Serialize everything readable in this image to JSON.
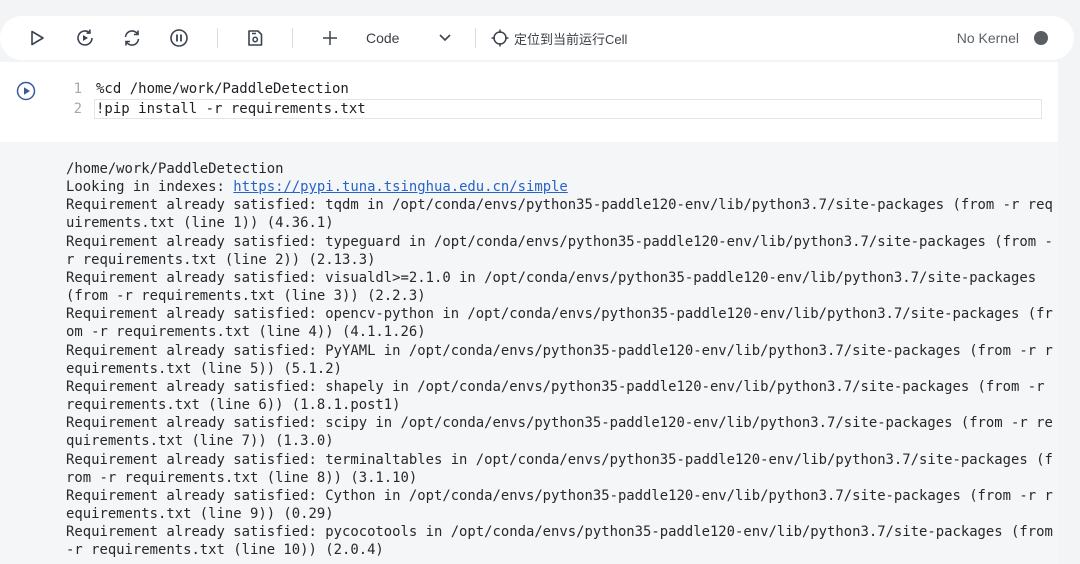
{
  "toolbar": {
    "cell_type": "Code",
    "locate_label": "定位到当前运行Cell",
    "kernel_status": "No Kernel",
    "icons": [
      "run-icon",
      "restart-run-icon",
      "restart-icon",
      "interrupt-icon",
      "save-icon",
      "add-icon",
      "chevron-down-icon",
      "locate-icon"
    ]
  },
  "cell": {
    "lines": [
      {
        "num": "1",
        "text": "%cd /home/work/PaddleDetection"
      },
      {
        "num": "2",
        "text": "!pip install -r requirements.txt"
      }
    ]
  },
  "output": {
    "line1": "/home/work/PaddleDetection",
    "index_prefix": "Looking in indexes: ",
    "index_url": "https://pypi.tuna.tsinghua.edu.cn/simple",
    "lines": [
      "Requirement already satisfied: tqdm in /opt/conda/envs/python35-paddle120-env/lib/python3.7/site-packages (from -r req",
      "uirements.txt (line 1)) (4.36.1)",
      "Requirement already satisfied: typeguard in /opt/conda/envs/python35-paddle120-env/lib/python3.7/site-packages (from -",
      "r requirements.txt (line 2)) (2.13.3)",
      "Requirement already satisfied: visualdl>=2.1.0 in /opt/conda/envs/python35-paddle120-env/lib/python3.7/site-packages",
      "(from -r requirements.txt (line 3)) (2.2.3)",
      "Requirement already satisfied: opencv-python in /opt/conda/envs/python35-paddle120-env/lib/python3.7/site-packages (fr",
      "om -r requirements.txt (line 4)) (4.1.1.26)",
      "Requirement already satisfied: PyYAML in /opt/conda/envs/python35-paddle120-env/lib/python3.7/site-packages (from -r r",
      "equirements.txt (line 5)) (5.1.2)",
      "Requirement already satisfied: shapely in /opt/conda/envs/python35-paddle120-env/lib/python3.7/site-packages (from -r",
      "requirements.txt (line 6)) (1.8.1.post1)",
      "Requirement already satisfied: scipy in /opt/conda/envs/python35-paddle120-env/lib/python3.7/site-packages (from -r re",
      "quirements.txt (line 7)) (1.3.0)",
      "Requirement already satisfied: terminaltables in /opt/conda/envs/python35-paddle120-env/lib/python3.7/site-packages (f",
      "rom -r requirements.txt (line 8)) (3.1.10)",
      "Requirement already satisfied: Cython in /opt/conda/envs/python35-paddle120-env/lib/python3.7/site-packages (from -r r",
      "equirements.txt (line 9)) (0.29)",
      "Requirement already satisfied: pycocotools in /opt/conda/envs/python35-paddle120-env/lib/python3.7/site-packages (from",
      "-r requirements.txt (line 10)) (2.0.4)"
    ]
  }
}
